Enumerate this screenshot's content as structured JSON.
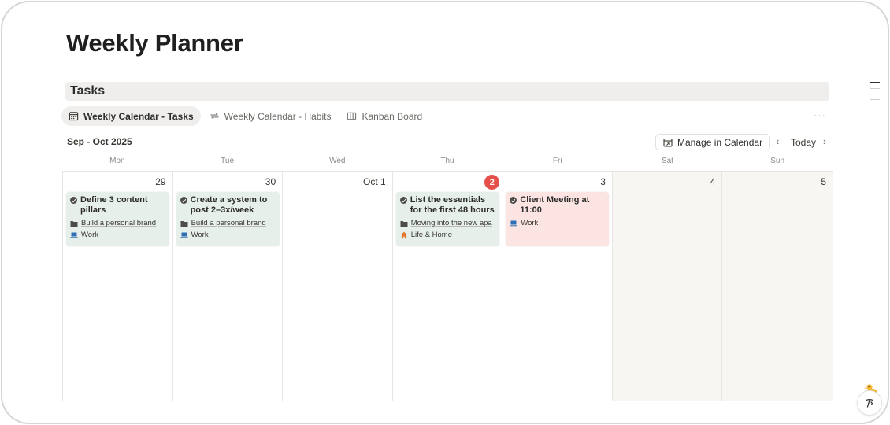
{
  "page": {
    "title": "Weekly Planner"
  },
  "section": {
    "title": "Tasks"
  },
  "views": {
    "tabs": [
      {
        "label": "Weekly Calendar - Tasks",
        "icon": "calendar-icon",
        "active": true
      },
      {
        "label": "Weekly Calendar - Habits",
        "icon": "repeat-icon",
        "active": false
      },
      {
        "label": "Kanban Board",
        "icon": "columns-icon",
        "active": false
      }
    ],
    "more_label": "···"
  },
  "calendar": {
    "month_label": "Sep - Oct 2025",
    "manage_label": "Manage in Calendar",
    "today_label": "Today",
    "prev_icon": "chevron-left-icon",
    "next_icon": "chevron-right-icon",
    "weekdays": [
      "Mon",
      "Tue",
      "Wed",
      "Thu",
      "Fri",
      "Sat",
      "Sun"
    ],
    "days": [
      {
        "num": "29"
      },
      {
        "num": "30"
      },
      {
        "num": "Oct 1"
      },
      {
        "num": "2",
        "today": true
      },
      {
        "num": "3"
      },
      {
        "num": "4"
      },
      {
        "num": "5"
      }
    ],
    "events": [
      {
        "title": "Define 3 content pillars",
        "project": "Build a personal brand",
        "area": "Work",
        "area_icon": "laptop-icon",
        "color": "#e7efea"
      },
      {
        "title": "Create a system to post 2–3x/week",
        "project": "Build a personal brand",
        "area": "Work",
        "area_icon": "laptop-icon",
        "color": "#e7efea"
      },
      {
        "title": "List the essentials for the first 48 hours",
        "project": "Moving into the new apa",
        "area": "Life & Home",
        "area_icon": "house-icon",
        "color": "#e7efea"
      },
      {
        "title": "Client Meeting at 11:00",
        "area": "Work",
        "area_icon": "laptop-icon",
        "color": "#fbe4e2"
      }
    ]
  },
  "colors": {
    "today_badge": "#e5504a",
    "card_green": "#e7efea",
    "card_red": "#fbe4e2",
    "weekend_bg": "#f7f6f3"
  }
}
